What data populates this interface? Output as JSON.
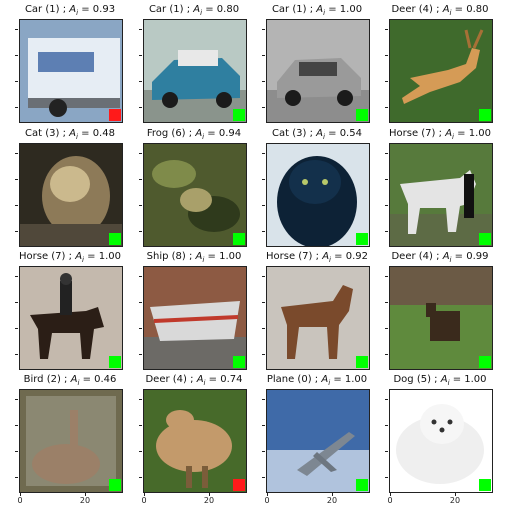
{
  "chart_data": {
    "type": "image_grid",
    "flag_colors": {
      "correct": "#00ff00",
      "incorrect": "#ff1a1a"
    },
    "x_tick_labels": [
      "0",
      "20"
    ],
    "cells": [
      {
        "label": "Car (1)",
        "score": "0.93",
        "flag": "incorrect",
        "icon": "truck-image"
      },
      {
        "label": "Car (1)",
        "score": "0.80",
        "flag": "correct",
        "icon": "vintage-car-image"
      },
      {
        "label": "Car (1)",
        "score": "1.00",
        "flag": "correct",
        "icon": "silver-car-image"
      },
      {
        "label": "Deer (4)",
        "score": "0.80",
        "flag": "correct",
        "icon": "leaping-deer-image"
      },
      {
        "label": "Cat (3)",
        "score": "0.48",
        "flag": "correct",
        "icon": "blurry-cat-image"
      },
      {
        "label": "Frog (6)",
        "score": "0.94",
        "flag": "correct",
        "icon": "frog-foliage-image"
      },
      {
        "label": "Cat (3)",
        "score": "0.54",
        "flag": "correct",
        "icon": "black-cat-image"
      },
      {
        "label": "Horse (7)",
        "score": "1.00",
        "flag": "correct",
        "icon": "white-horse-image"
      },
      {
        "label": "Horse (7)",
        "score": "1.00",
        "flag": "correct",
        "icon": "horse-rider-image"
      },
      {
        "label": "Ship (8)",
        "score": "1.00",
        "flag": "correct",
        "icon": "boat-image"
      },
      {
        "label": "Horse (7)",
        "score": "0.92",
        "flag": "correct",
        "icon": "brown-horse-image"
      },
      {
        "label": "Deer (4)",
        "score": "0.99",
        "flag": "correct",
        "icon": "deer-field-image"
      },
      {
        "label": "Bird (2)",
        "score": "0.46",
        "flag": "correct",
        "icon": "emu-image"
      },
      {
        "label": "Deer (4)",
        "score": "0.74",
        "flag": "incorrect",
        "icon": "ostrich-image"
      },
      {
        "label": "Plane (0)",
        "score": "1.00",
        "flag": "correct",
        "icon": "fighter-jet-image"
      },
      {
        "label": "Dog (5)",
        "score": "1.00",
        "flag": "correct",
        "icon": "white-dog-image"
      }
    ]
  }
}
